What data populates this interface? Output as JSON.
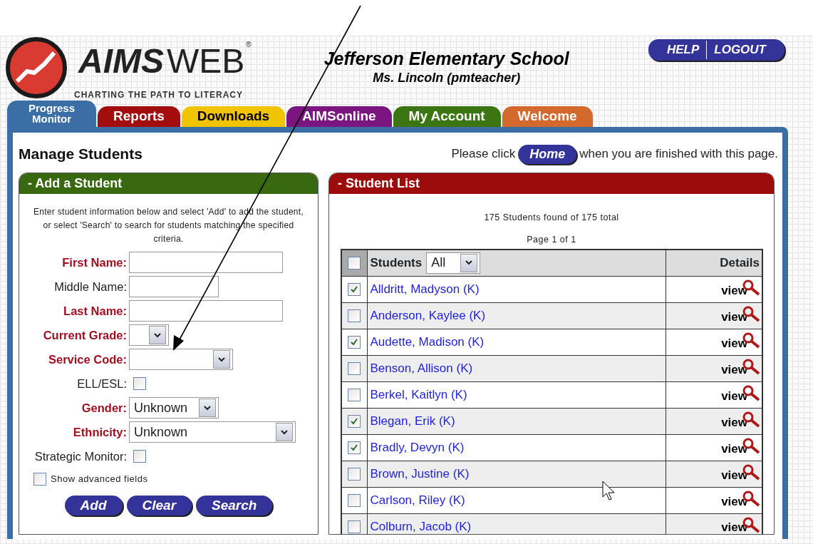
{
  "header": {
    "logo": {
      "bold": "AIMS",
      "light": "WEB",
      "mark": "®"
    },
    "tagline": "CHARTING THE PATH TO LITERACY",
    "school": "Jefferson Elementary School",
    "teacher": "Ms. Lincoln (pmteacher)",
    "links": [
      "HELP",
      "LOGOUT"
    ]
  },
  "tabs": [
    {
      "label": "Progress Monitor",
      "color": "#3a6ea5",
      "selected": true
    },
    {
      "label": "Reports",
      "color": "#a30d0d",
      "selected": false
    },
    {
      "label": "Downloads",
      "color": "#f2c400",
      "selected": false
    },
    {
      "label": "AIMSonline",
      "color": "#7b1680",
      "selected": false
    },
    {
      "label": "My Account",
      "color": "#3b7612",
      "selected": false
    },
    {
      "label": "Welcome",
      "color": "#d4692e",
      "selected": false
    }
  ],
  "page_title": "Manage Students",
  "notice": {
    "before": "Please click",
    "button": "Home",
    "after": "when you are finished with this page."
  },
  "add_panel": {
    "title": "- Add a Student",
    "instructions": "Enter student information below and select 'Add' to add the student, or select 'Search' to search for students matching the specified criteria.",
    "fields": [
      {
        "kind": "text",
        "label": "First Name:",
        "required": true
      },
      {
        "kind": "text",
        "label": "Middle Name:",
        "required": false
      },
      {
        "kind": "text",
        "label": "Last Name:",
        "required": true
      },
      {
        "kind": "select",
        "label": "Current Grade:",
        "required": true
      },
      {
        "kind": "select",
        "label": "Service Code:",
        "required": true
      },
      {
        "kind": "checkbox",
        "label": "ELL/ESL:",
        "required": false,
        "checked": false
      },
      {
        "kind": "select",
        "label": "Gender:",
        "required": true,
        "value": "Unknown"
      },
      {
        "kind": "select",
        "label": "Ethnicity:",
        "required": true,
        "value": "Unknown"
      },
      {
        "kind": "checkbox",
        "label": "Strategic Monitor:",
        "required": false,
        "checked": false
      }
    ],
    "advanced": {
      "label": "Show advanced fields",
      "checked": false
    },
    "buttons": [
      "Add",
      "Clear",
      "Search"
    ]
  },
  "student_list": {
    "title": "- Student List",
    "found": "175 Students found of 175 total",
    "page": "Page 1 of 1",
    "header": {
      "checked": false,
      "students": "Students",
      "filter": "All",
      "details": "Details"
    },
    "rows": [
      {
        "name": "Alldritt, Madyson (K)",
        "checked": true,
        "view": "view"
      },
      {
        "name": "Anderson, Kaylee (K)",
        "checked": false,
        "view": "view"
      },
      {
        "name": "Audette, Madison (K)",
        "checked": true,
        "view": "view"
      },
      {
        "name": "Benson, Allison (K)",
        "checked": false,
        "view": "view"
      },
      {
        "name": "Berkel, Kaitlyn (K)",
        "checked": false,
        "view": "view"
      },
      {
        "name": "Blegan, Erik (K)",
        "checked": true,
        "view": "view"
      },
      {
        "name": "Bradly, Devyn (K)",
        "checked": true,
        "view": "view"
      },
      {
        "name": "Brown, Justine (K)",
        "checked": false,
        "view": "view"
      },
      {
        "name": "Carlson, Riley (K)",
        "checked": false,
        "view": "view"
      },
      {
        "name": "Colburn, Jacob (K)",
        "checked": false,
        "view": "view"
      }
    ]
  }
}
